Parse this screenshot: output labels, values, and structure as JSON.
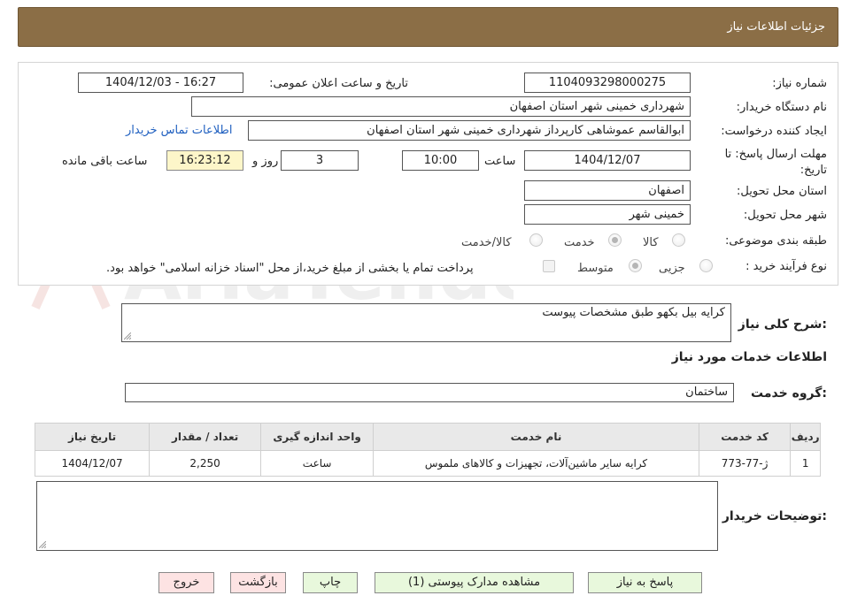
{
  "header": {
    "title": "جزئیات اطلاعات نیاز"
  },
  "form": {
    "need_number_label": "شماره نیاز:",
    "need_number": "1104093298000275",
    "announce_label": "تاریخ و ساعت اعلان عمومی:",
    "announce_value": "1404/12/03 - 16:27",
    "buyer_org_label": "نام دستگاه خریدار:",
    "buyer_org": "شهرداری خمینی شهر استان اصفهان",
    "creator_label": "ایجاد کننده درخواست:",
    "creator": "ابوالقاسم عموشاهی کارپرداز شهرداری خمینی شهر استان اصفهان",
    "contact_link": "اطلاعات تماس خریدار",
    "deadline_label": "مهلت ارسال پاسخ: تا تاریخ:",
    "deadline_date": "1404/12/07",
    "time_label": "ساعت",
    "deadline_time": "10:00",
    "days": "3",
    "days_label": "روز و",
    "remaining": "16:23:12",
    "remaining_label": "ساعت باقی مانده",
    "province_label": "استان محل تحویل:",
    "province": "اصفهان",
    "city_label": "شهر محل تحویل:",
    "city": "خمینی شهر",
    "category_label": "طبقه بندی موضوعی:",
    "category_options": [
      "کالا",
      "خدمت",
      "کالا/خدمت"
    ],
    "purchase_type_label": "نوع فرآیند خرید :",
    "purchase_options": [
      "جزیی",
      "متوسط"
    ],
    "payment_note": "پرداخت تمام یا بخشی از مبلغ خرید،از محل \"اسناد خزانه اسلامی\" خواهد بود."
  },
  "summary": {
    "label": "شرح کلی نیاز:",
    "text": "کرایه بیل بکهو طبق مشخصات پیوست"
  },
  "services": {
    "title": "اطلاعات خدمات مورد نیاز",
    "group_label": "گروه خدمت:",
    "group_value": "ساختمان",
    "columns": [
      "ردیف",
      "کد خدمت",
      "نام خدمت",
      "واحد اندازه گیری",
      "تعداد / مقدار",
      "تاریخ نیاز"
    ],
    "rows": [
      [
        "1",
        "ژ-77-773",
        "کرایه سایر ماشین‌آلات، تجهیزات و کالاهای ملموس",
        "ساعت",
        "2,250",
        "1404/12/07"
      ]
    ]
  },
  "buyer_notes": {
    "label": "توضیحات خریدار:",
    "text": ""
  },
  "buttons": {
    "reply": "پاسخ به نیاز",
    "attachments": "مشاهده مدارک پیوستی (1)",
    "print": "چاپ",
    "back": "بازگشت",
    "exit": "خروج"
  },
  "watermark": {
    "text": "AriaTender.neT"
  },
  "colors": {
    "header_bg": "#8b6e46",
    "link": "#2060c0",
    "green_button": "#e8f8dc",
    "pink_button": "#fde3e3",
    "remaining_bg": "#fdf6c9"
  }
}
